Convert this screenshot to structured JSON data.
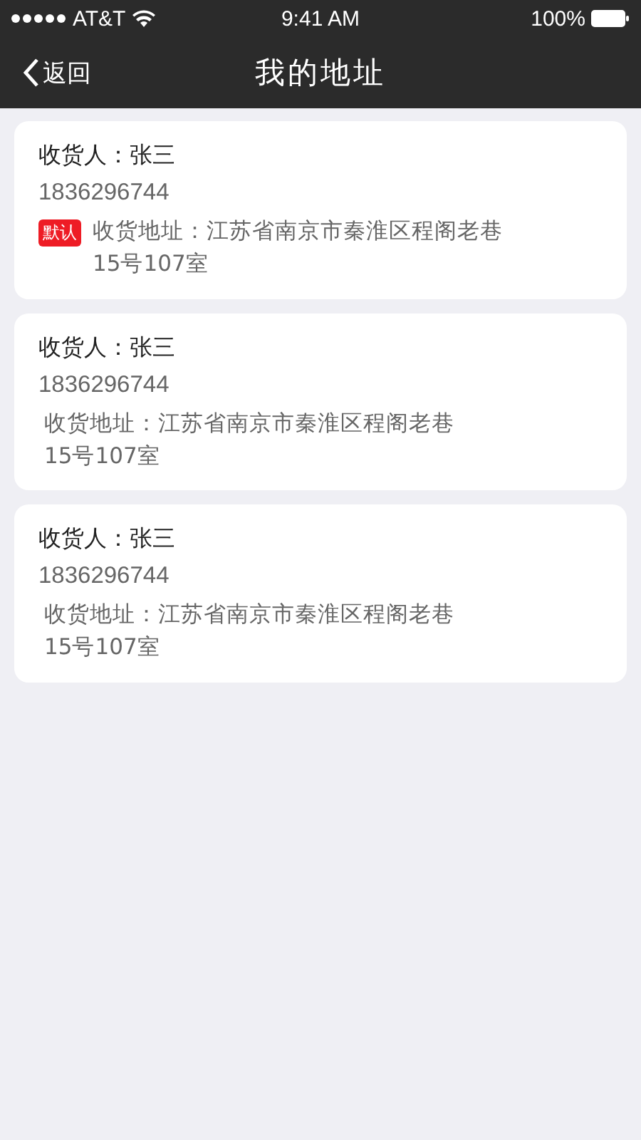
{
  "status_bar": {
    "carrier": "AT&T",
    "time": "9:41 AM",
    "battery": "100%"
  },
  "nav_bar": {
    "back": "返回",
    "title": "我的地址"
  },
  "default_badge": "默认",
  "addresses": [
    {
      "recipient": "收货人：张三",
      "phone": "1836296744",
      "address": "收货地址：江苏省南京市秦淮区程阁老巷15号107室",
      "default": true
    },
    {
      "recipient": "收货人：张三",
      "phone": "1836296744",
      "address": "收货地址：江苏省南京市秦淮区程阁老巷15号107室",
      "default": false
    },
    {
      "recipient": "收货人：张三",
      "phone": "1836296744",
      "address": "收货地址：江苏省南京市秦淮区程阁老巷15号107室",
      "default": false
    }
  ]
}
